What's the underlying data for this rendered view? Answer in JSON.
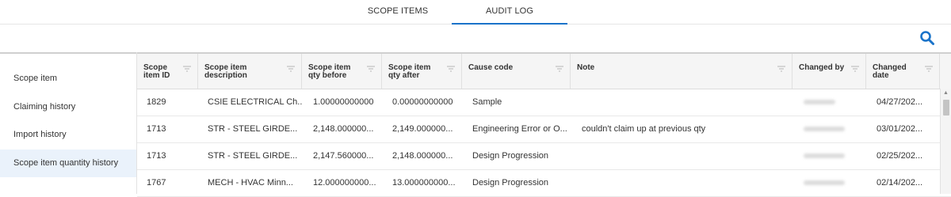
{
  "tabs": [
    {
      "label": "SCOPE ITEMS",
      "active": false
    },
    {
      "label": "AUDIT LOG",
      "active": true
    }
  ],
  "accent_color": "#1a73c9",
  "sidebar": {
    "items": [
      {
        "label": "Scope item",
        "active": false
      },
      {
        "label": "Claiming history",
        "active": false
      },
      {
        "label": "Import history",
        "active": false
      },
      {
        "label": "Scope item quantity history",
        "active": true
      }
    ]
  },
  "table": {
    "columns": [
      {
        "label": "Scope item ID"
      },
      {
        "label": "Scope item description"
      },
      {
        "label": "Scope item qty before"
      },
      {
        "label": "Scope item qty after"
      },
      {
        "label": "Cause code"
      },
      {
        "label": "Note"
      },
      {
        "label": "Changed by"
      },
      {
        "label": "Changed date"
      }
    ],
    "rows": [
      [
        "1829",
        "CSIE ELECTRICAL Ch...",
        "1.00000000000",
        "0.00000000000",
        "Sample",
        "",
        "",
        "04/27/202..."
      ],
      [
        "1713",
        "STR - STEEL GIRDE...",
        "2,148.000000...",
        "2,149.000000...",
        "Engineering Error or O...",
        "couldn't claim up at previous qty",
        "",
        "03/01/202..."
      ],
      [
        "1713",
        "STR - STEEL GIRDE...",
        "2,147.560000...",
        "2,148.000000...",
        "Design Progression",
        "",
        "",
        "02/25/202..."
      ],
      [
        "1767",
        "MECH - HVAC Minn...",
        "12.000000000...",
        "13.000000000...",
        "Design Progression",
        "",
        "",
        "02/14/202..."
      ]
    ]
  }
}
